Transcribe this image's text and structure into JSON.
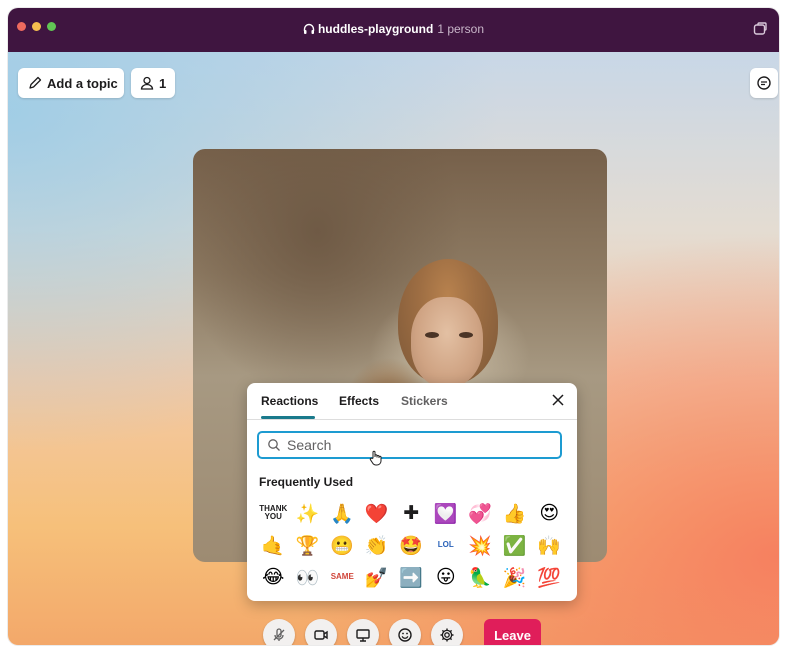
{
  "window": {
    "title": "huddles-playground",
    "subtitle": "1 person",
    "traffic_lights": [
      "#ed6a5e",
      "#f5bf4f",
      "#61c554"
    ],
    "titlebar_color": "#3f1540"
  },
  "topbar": {
    "add_topic_label": "Add a topic",
    "participants_count": "1"
  },
  "picker": {
    "tabs": [
      {
        "label": "Reactions",
        "active": true
      },
      {
        "label": "Effects",
        "active": false
      },
      {
        "label": "Stickers",
        "active": false
      }
    ],
    "search_placeholder": "Search",
    "section_title": "Frequently Used",
    "emojis": [
      {
        "name": "thank-you",
        "glyph": "THANK YOU",
        "text": true,
        "color": "#1d1c1d"
      },
      {
        "name": "sparkles",
        "glyph": "✨",
        "text": false
      },
      {
        "name": "pray",
        "glyph": "🙏",
        "text": false
      },
      {
        "name": "heart",
        "glyph": "❤️",
        "text": false
      },
      {
        "name": "heavy-plus",
        "glyph": "✚",
        "text": false
      },
      {
        "name": "ty-heart",
        "glyph": "💟",
        "text": false
      },
      {
        "name": "sparkling-heart",
        "glyph": "💞",
        "text": false
      },
      {
        "name": "thumbsup",
        "glyph": "👍",
        "text": false
      },
      {
        "name": "heart-eyes",
        "glyph": "😍",
        "text": false
      },
      {
        "name": "call-me",
        "glyph": "🤙",
        "text": false
      },
      {
        "name": "trophy",
        "glyph": "🏆",
        "text": false
      },
      {
        "name": "grimacing",
        "glyph": "😬",
        "text": false
      },
      {
        "name": "clap",
        "glyph": "👏",
        "text": false
      },
      {
        "name": "star-struck",
        "glyph": "🤩",
        "text": false
      },
      {
        "name": "lol",
        "glyph": "LOL",
        "text": true,
        "color": "#2a62b8"
      },
      {
        "name": "boom",
        "glyph": "💥",
        "text": false
      },
      {
        "name": "check",
        "glyph": "✅",
        "text": false
      },
      {
        "name": "raised-hands",
        "glyph": "🙌",
        "text": false
      },
      {
        "name": "joy",
        "glyph": "😂",
        "text": false
      },
      {
        "name": "eyes",
        "glyph": "👀",
        "text": false
      },
      {
        "name": "same",
        "glyph": "SAME",
        "text": true,
        "color": "#d0453a"
      },
      {
        "name": "nail-polish",
        "glyph": "💅",
        "text": false
      },
      {
        "name": "arrow-right",
        "glyph": "➡️",
        "text": false
      },
      {
        "name": "tongue",
        "glyph": "😛",
        "text": false
      },
      {
        "name": "party-parrot",
        "glyph": "🦜",
        "text": false
      },
      {
        "name": "tada",
        "glyph": "🎉",
        "text": false
      },
      {
        "name": "perfect",
        "glyph": "💯",
        "text": false
      }
    ]
  },
  "controls": {
    "buttons": [
      {
        "name": "mic-off-button",
        "icon": "mic-off-icon"
      },
      {
        "name": "video-button",
        "icon": "video-icon"
      },
      {
        "name": "screen-share-button",
        "icon": "screen-share-icon"
      },
      {
        "name": "reactions-button",
        "icon": "smiley-icon"
      },
      {
        "name": "settings-button",
        "icon": "gear-icon"
      }
    ],
    "leave_label": "Leave",
    "leave_color": "#e01e5a"
  }
}
